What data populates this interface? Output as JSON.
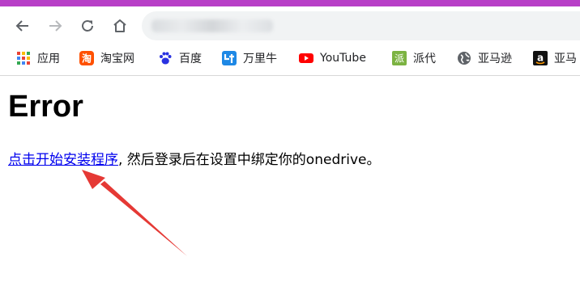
{
  "toolbar": {
    "back_icon": "arrow-left-icon",
    "forward_icon": "arrow-right-icon",
    "reload_icon": "reload-icon",
    "home_icon": "home-icon"
  },
  "bookmarks": [
    {
      "label": "应用",
      "icon": "apps-grid-icon"
    },
    {
      "label": "淘宝网",
      "icon": "taobao-icon"
    },
    {
      "label": "百度",
      "icon": "baidu-paw-icon"
    },
    {
      "label": "万里牛",
      "icon": "wanliniu-icon"
    },
    {
      "label": "YouTube",
      "icon": "youtube-icon"
    },
    {
      "label": "派代",
      "icon": "paidai-icon"
    },
    {
      "label": "亚马逊",
      "icon": "globe-icon"
    },
    {
      "label": "亚马",
      "icon": "amazon-icon"
    }
  ],
  "page": {
    "heading": "Error",
    "link_text": "点击开始安装程序",
    "message": ", 然后登录后在设置中绑定你的onedrive。"
  },
  "colors": {
    "top_strip": "#b83fc7",
    "link": "#0000ee",
    "annotation_arrow": "#e53935"
  }
}
